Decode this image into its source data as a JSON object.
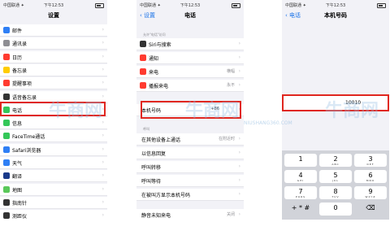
{
  "status": {
    "carrier": "中国联通 ✦",
    "time": "下午12:53"
  },
  "screen1": {
    "title": "设置",
    "items": [
      {
        "label": "邮件",
        "color": "#2f7ff5"
      },
      {
        "label": "通讯录",
        "color": "#8e8e93"
      },
      {
        "label": "日历",
        "color": "#ff3b30"
      },
      {
        "label": "备忘录",
        "color": "#ffcc00"
      },
      {
        "label": "提醒事项",
        "color": "#ff3b30"
      },
      {
        "label": "语音备忘录",
        "color": "#333333"
      },
      {
        "label": "电话",
        "color": "#34c759"
      },
      {
        "label": "信息",
        "color": "#34c759"
      },
      {
        "label": "FaceTime通话",
        "color": "#34c759"
      },
      {
        "label": "Safari浏览器",
        "color": "#2f7ff5"
      },
      {
        "label": "天气",
        "color": "#2f7ff5"
      },
      {
        "label": "翻译",
        "color": "#1a3a8a"
      },
      {
        "label": "地图",
        "color": "#5ac85a"
      },
      {
        "label": "指南针",
        "color": "#333333"
      },
      {
        "label": "测距仪",
        "color": "#333333"
      }
    ]
  },
  "screen2": {
    "back": "设置",
    "title": "电话",
    "section_caption": "允许\"电话\"访问",
    "allow_items": [
      {
        "label": "Siri与搜索",
        "value": "",
        "color": "#333333"
      },
      {
        "label": "通知",
        "value": "",
        "color": "#ff3b30"
      },
      {
        "label": "来电",
        "value": "横幅",
        "color": "#ff3b30"
      },
      {
        "label": "播报来电",
        "value": "永不",
        "color": "#ff3b30"
      }
    ],
    "my_number": {
      "label": "本机号码",
      "value": "+86"
    },
    "calls_caption": "呼叫",
    "call_items": [
      {
        "label": "在其他设备上通话",
        "value": "在附近时"
      },
      {
        "label": "以信息回复",
        "value": ""
      },
      {
        "label": "呼叫转移",
        "value": ""
      },
      {
        "label": "呼叫等待",
        "value": ""
      },
      {
        "label": "在被叫方显示本机号码",
        "value": ""
      }
    ],
    "bottom_item": {
      "label": "静音未知来电",
      "value": "关闭"
    }
  },
  "screen3": {
    "back": "电话",
    "title": "本机号码",
    "input_value": "10010",
    "keys": [
      {
        "num": "1",
        "sub": ""
      },
      {
        "num": "2",
        "sub": "ABC"
      },
      {
        "num": "3",
        "sub": "DEF"
      },
      {
        "num": "4",
        "sub": "GHI"
      },
      {
        "num": "5",
        "sub": "JKL"
      },
      {
        "num": "6",
        "sub": "MNO"
      },
      {
        "num": "7",
        "sub": "PQRS"
      },
      {
        "num": "8",
        "sub": "TUV"
      },
      {
        "num": "9",
        "sub": "WXYZ"
      },
      {
        "num": "+ * #",
        "sub": ""
      },
      {
        "num": "0",
        "sub": ""
      },
      {
        "num": "⌫",
        "sub": ""
      }
    ]
  },
  "watermark": {
    "text": "牛商网",
    "url": "NIUSHANG360.COM"
  },
  "colors": {
    "highlight": "#e0271f",
    "link": "#1a73e8"
  }
}
